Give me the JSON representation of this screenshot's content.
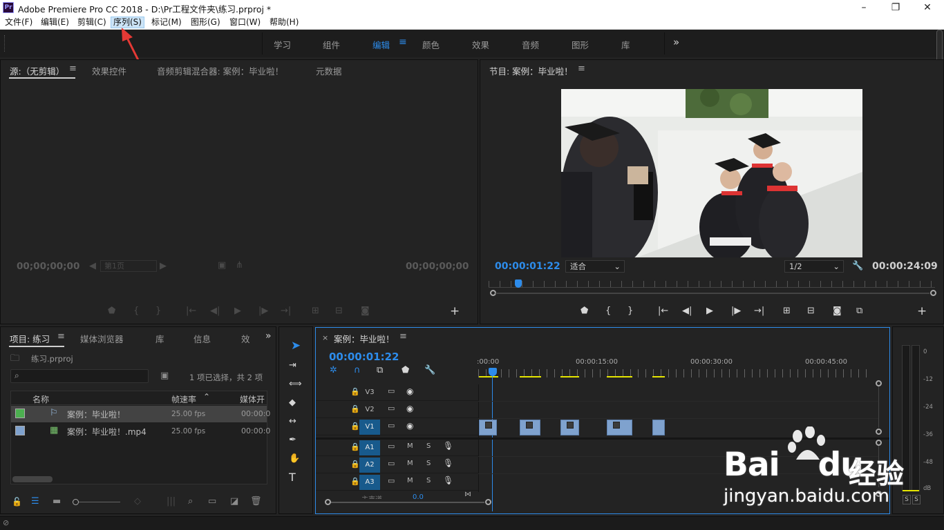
{
  "window": {
    "title": "Adobe Premiere Pro CC 2018 - D:\\Pr工程文件夹\\练习.prproj *",
    "logo": "Pr",
    "min": "–",
    "max": "❐",
    "close": "✕"
  },
  "menu": [
    "文件(F)",
    "编辑(E)",
    "剪辑(C)",
    "序列(S)",
    "标记(M)",
    "图形(G)",
    "窗口(W)",
    "帮助(H)"
  ],
  "workspaces": {
    "tabs": [
      "学习",
      "组件",
      "编辑",
      "颜色",
      "效果",
      "音频",
      "图形",
      "库"
    ],
    "active": "编辑",
    "more": "»"
  },
  "source_panel": {
    "tabs": [
      "源:（无剪辑）",
      "效果控件",
      "音频剪辑混合器: 案例：毕业啦！",
      "元数据"
    ],
    "tc_in": "00;00;00;00",
    "tc_out": "00;00;00;00",
    "page": "第1页"
  },
  "program_panel": {
    "title": "节目: 案例：毕业啦！",
    "tc_current": "00:00:01:22",
    "fit": "适合",
    "resolution": "1/2",
    "tc_duration": "00:00:24:09",
    "playhead_fraction": 0.066
  },
  "project_panel": {
    "tabs": [
      "项目: 练习",
      "媒体浏览器",
      "库",
      "信息",
      "效"
    ],
    "project_file": "练习.prproj",
    "selection_status": "1 项已选择，共 2 项",
    "columns": [
      "名称",
      "帧速率",
      "媒体开"
    ],
    "items": [
      {
        "name": "案例：毕业啦！",
        "fps": "25.00 fps",
        "start": "00:00:0",
        "color": "#4caf50"
      },
      {
        "name": "案例：毕业啦！.mp4",
        "fps": "25.00 fps",
        "start": "00:00:0",
        "color": "#7fa2ce"
      }
    ]
  },
  "timeline": {
    "title": "案例：毕业啦！",
    "close": "×",
    "timecode": "00:00:01:22",
    "ruler": [
      ":00:00",
      "00:00:15:00",
      "00:00:30:00",
      "00:00:45:00"
    ],
    "video_tracks": [
      "V3",
      "V2",
      "V1"
    ],
    "audio_tracks": [
      "A1",
      "A2",
      "A3"
    ],
    "master": "主声道",
    "master_val": "0.0",
    "mute": "M",
    "solo": "S"
  },
  "meter": {
    "ticks": [
      "0",
      "-12",
      "-24",
      "-36",
      "-48",
      "dB"
    ],
    "solo_left": "S",
    "solo_right": "S"
  },
  "watermark": {
    "brand": "Bai",
    "brand2": "du",
    "cn": "经验",
    "url": "jingyan.baidu.com"
  },
  "colors": {
    "accent": "#2d8ceb",
    "clip": "#7fa2ce",
    "track_on": "#185a8c",
    "annotation": "#e53935"
  }
}
